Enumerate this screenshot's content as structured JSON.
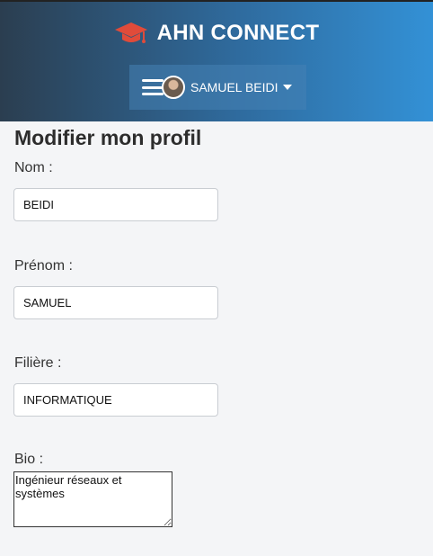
{
  "header": {
    "brand_title": "AHN CONNECT",
    "brand_icon": "graduation-cap-icon",
    "brand_icon_color": "#e04b3a",
    "user_name": "SAMUEL BEIDI",
    "menu_icon": "hamburger-menu-icon",
    "dropdown_icon": "caret-down-icon",
    "gradient_colors": [
      "#2b3e50",
      "#3391d6"
    ]
  },
  "form": {
    "title": "Modifier mon profil",
    "fields": {
      "nom": {
        "label": "Nom :",
        "value": "BEIDI"
      },
      "prenom": {
        "label": "Prénom :",
        "value": "SAMUEL"
      },
      "filiere": {
        "label": "Filière :",
        "value": "INFORMATIQUE"
      },
      "bio": {
        "label": "Bio :",
        "value": "Ingénieur réseaux et systèmes"
      }
    }
  }
}
